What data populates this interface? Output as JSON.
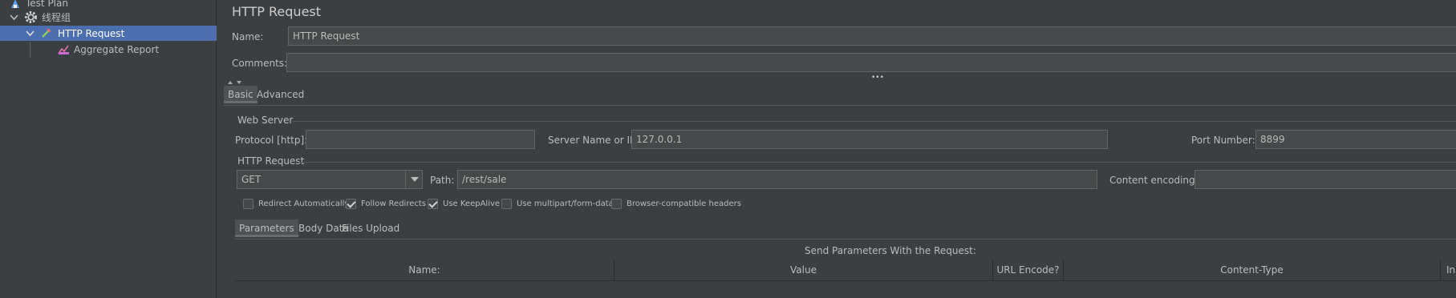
{
  "tree": {
    "test_plan": "Test Plan",
    "thread_group": "线程组",
    "http_request": "HTTP Request",
    "aggregate_report": "Aggregate Report"
  },
  "panel": {
    "title": "HTTP Request",
    "name_label": "Name:",
    "name_value": "HTTP Request",
    "comments_label": "Comments:",
    "comments_value": "",
    "ellipsis": "•••",
    "tabs": [
      "Basic",
      "Advanced"
    ],
    "web_server": {
      "section": "Web Server",
      "protocol_label": "Protocol [http]:",
      "protocol_value": "",
      "server_label": "Server Name or IP:",
      "server_value": "127.0.0.1",
      "port_label": "Port Number:",
      "port_value": "8899"
    },
    "http_request": {
      "section": "HTTP Request",
      "method": "GET",
      "path_label": "Path:",
      "path_value": "/rest/sale",
      "encoding_label": "Content encoding:",
      "encoding_value": ""
    },
    "checkboxes": [
      {
        "label": "Redirect Automatically",
        "checked": false
      },
      {
        "label": "Follow Redirects",
        "checked": true
      },
      {
        "label": "Use KeepAlive",
        "checked": true
      },
      {
        "label": "Use multipart/form-data",
        "checked": false
      },
      {
        "label": "Browser-compatible headers",
        "checked": false
      }
    ],
    "sub_tabs": [
      "Parameters",
      "Body Data",
      "Files Upload"
    ],
    "params_caption": "Send Parameters With the Request:",
    "columns": [
      "Name:",
      "Value",
      "URL Encode?",
      "Content-Type",
      "In"
    ]
  },
  "colors": {
    "background": "#3c3f41",
    "selection": "#4b6eaf",
    "field": "#45494a"
  }
}
